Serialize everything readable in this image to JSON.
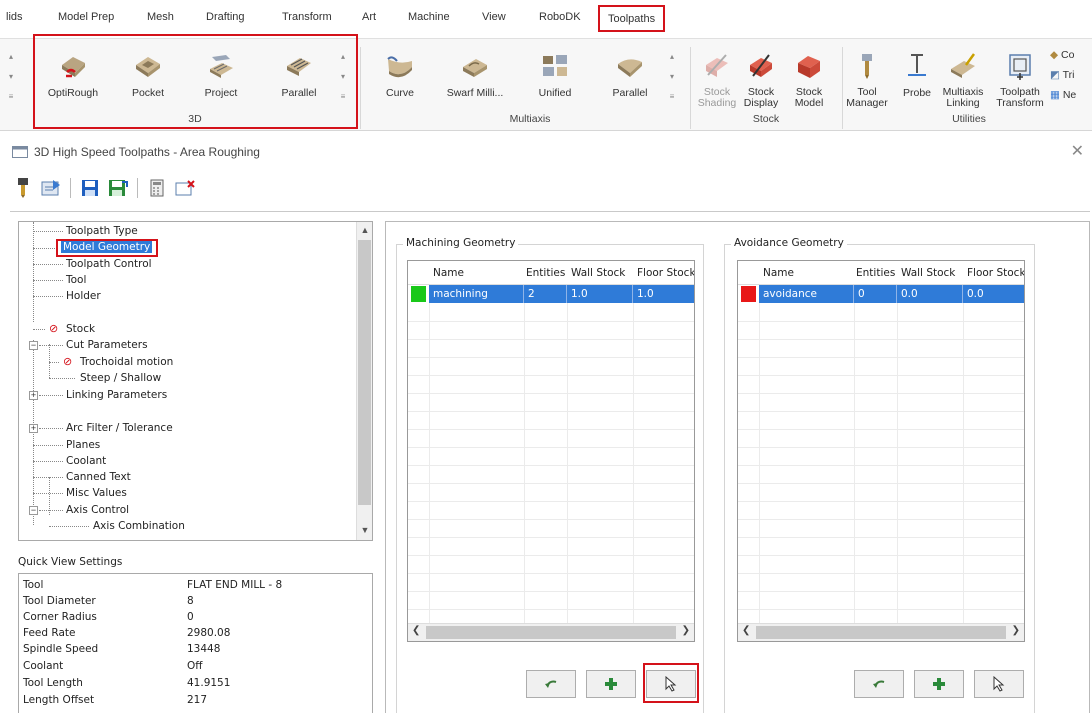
{
  "ribbon": {
    "tabs": [
      "lids",
      "Model Prep",
      "Mesh",
      "Drafting",
      "Transform",
      "Art",
      "Machine",
      "View",
      "RoboDK",
      "Toolpaths"
    ],
    "active_tab": "Toolpaths",
    "groups": {
      "g3d": {
        "label": "3D",
        "buttons": [
          "OptiRough",
          "Pocket",
          "Project",
          "Parallel"
        ]
      },
      "multiaxis": {
        "label": "Multiaxis",
        "buttons": [
          "Curve",
          "Swarf Milli...",
          "Unified",
          "Parallel"
        ]
      },
      "stock": {
        "label": "Stock",
        "buttons": [
          "Stock Shading",
          "Stock Display",
          "Stock Model"
        ]
      },
      "utilities": {
        "label": "Utilities",
        "buttons": [
          "Tool Manager",
          "Probe",
          "Multiaxis Linking",
          "Toolpath Transform"
        ],
        "side_items": [
          "Co",
          "Tri",
          "Ne"
        ]
      }
    }
  },
  "dialog": {
    "title": "3D High Speed Toolpaths - Area Roughing",
    "tree": {
      "items": [
        "Toolpath Type",
        "Model Geometry",
        "Toolpath Control",
        "Tool",
        "Holder",
        "Stock",
        "Cut Parameters",
        "Trochoidal motion",
        "Steep / Shallow",
        "Linking Parameters",
        "Arc Filter / Tolerance",
        "Planes",
        "Coolant",
        "Canned Text",
        "Misc Values",
        "Axis Control",
        "Axis Combination"
      ]
    },
    "quick_view": {
      "label": "Quick View Settings",
      "rows": [
        {
          "k": "Tool",
          "v": "FLAT END MILL - 8"
        },
        {
          "k": "Tool Diameter",
          "v": "8"
        },
        {
          "k": "Corner Radius",
          "v": "0"
        },
        {
          "k": "Feed Rate",
          "v": "2980.08"
        },
        {
          "k": "Spindle Speed",
          "v": "13448"
        },
        {
          "k": "Coolant",
          "v": "Off"
        },
        {
          "k": "Tool Length",
          "v": "41.9151"
        },
        {
          "k": "Length Offset",
          "v": "217"
        }
      ]
    },
    "machining": {
      "title": "Machining Geometry",
      "columns": [
        "Name",
        "Entities",
        "Wall Stock",
        "Floor Stock"
      ],
      "row": {
        "name": "machining",
        "entities": "2",
        "wall": "1.0",
        "floor": "1.0",
        "color": "#19c819"
      }
    },
    "avoidance": {
      "title": "Avoidance Geometry",
      "columns": [
        "Name",
        "Entities",
        "Wall Stock",
        "Floor Stock"
      ],
      "row": {
        "name": "avoidance",
        "entities": "0",
        "wall": "0.0",
        "floor": "0.0",
        "color": "#e81818"
      }
    }
  },
  "colors": {
    "highlight": "#d4121a",
    "selection": "#2f7bd8"
  }
}
